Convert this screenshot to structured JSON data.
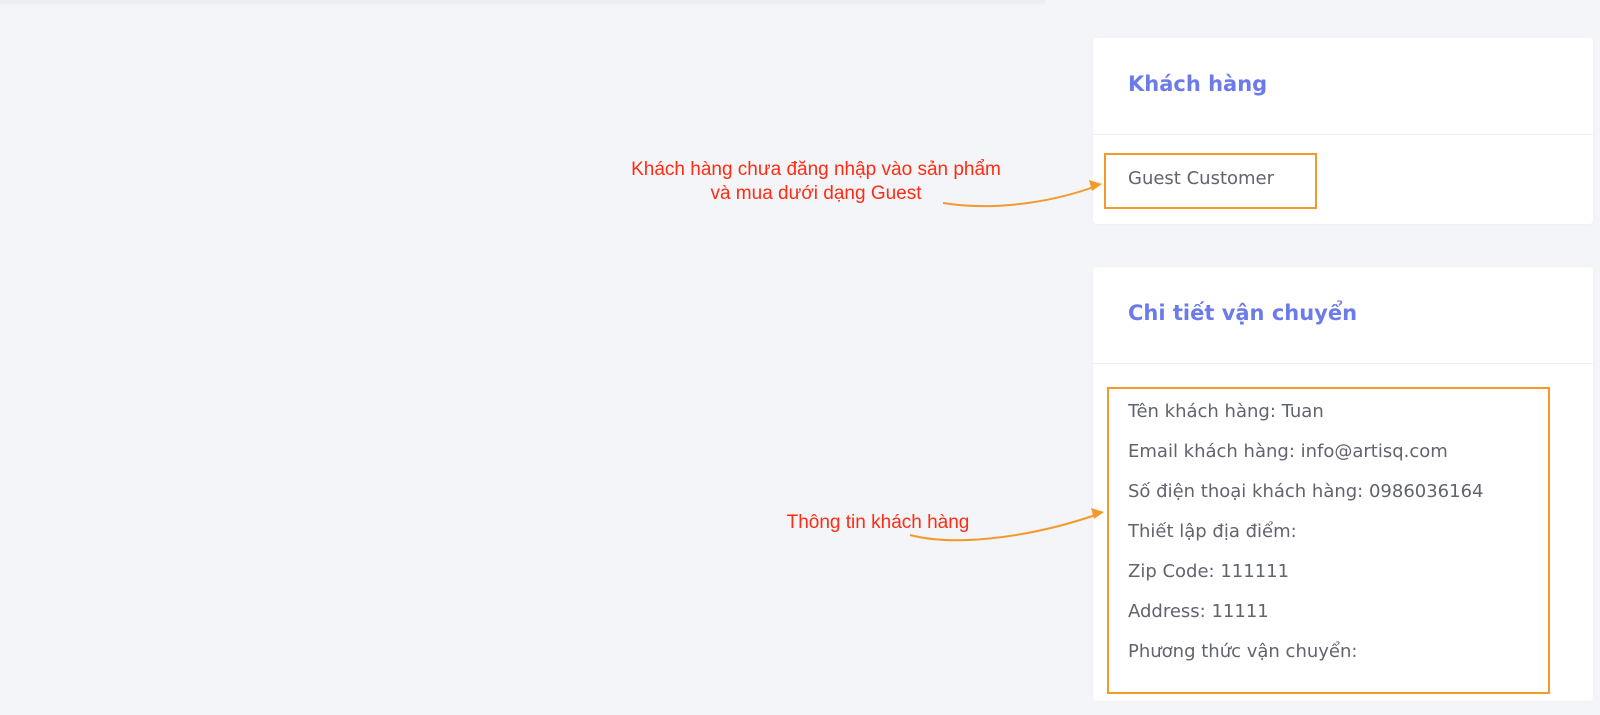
{
  "customer_card": {
    "title": "Khách hàng",
    "value": "Guest Customer"
  },
  "shipping_card": {
    "title": "Chi tiết vận chuyển",
    "lines": [
      "Tên khách hàng: Tuan",
      "Email khách hàng: info@artisq.com",
      "Số điện thoại khách hàng: 0986036164",
      "Thiết lập địa điểm:",
      "Zip Code: 111111",
      "Address: 11111",
      "Phương thức vận chuyển:"
    ]
  },
  "annotations": {
    "guest_note_line1": "Khách hàng chưa đăng nhập vào sản phẩm",
    "guest_note_line2": "và mua dưới dạng Guest",
    "info_note": "Thông tin khách hàng"
  },
  "colors": {
    "background": "#f4f5f8",
    "card_title": "#6c7bea",
    "body_text": "#5f646d",
    "annotation_text": "#ff2b12",
    "callout": "#f39a2d"
  }
}
